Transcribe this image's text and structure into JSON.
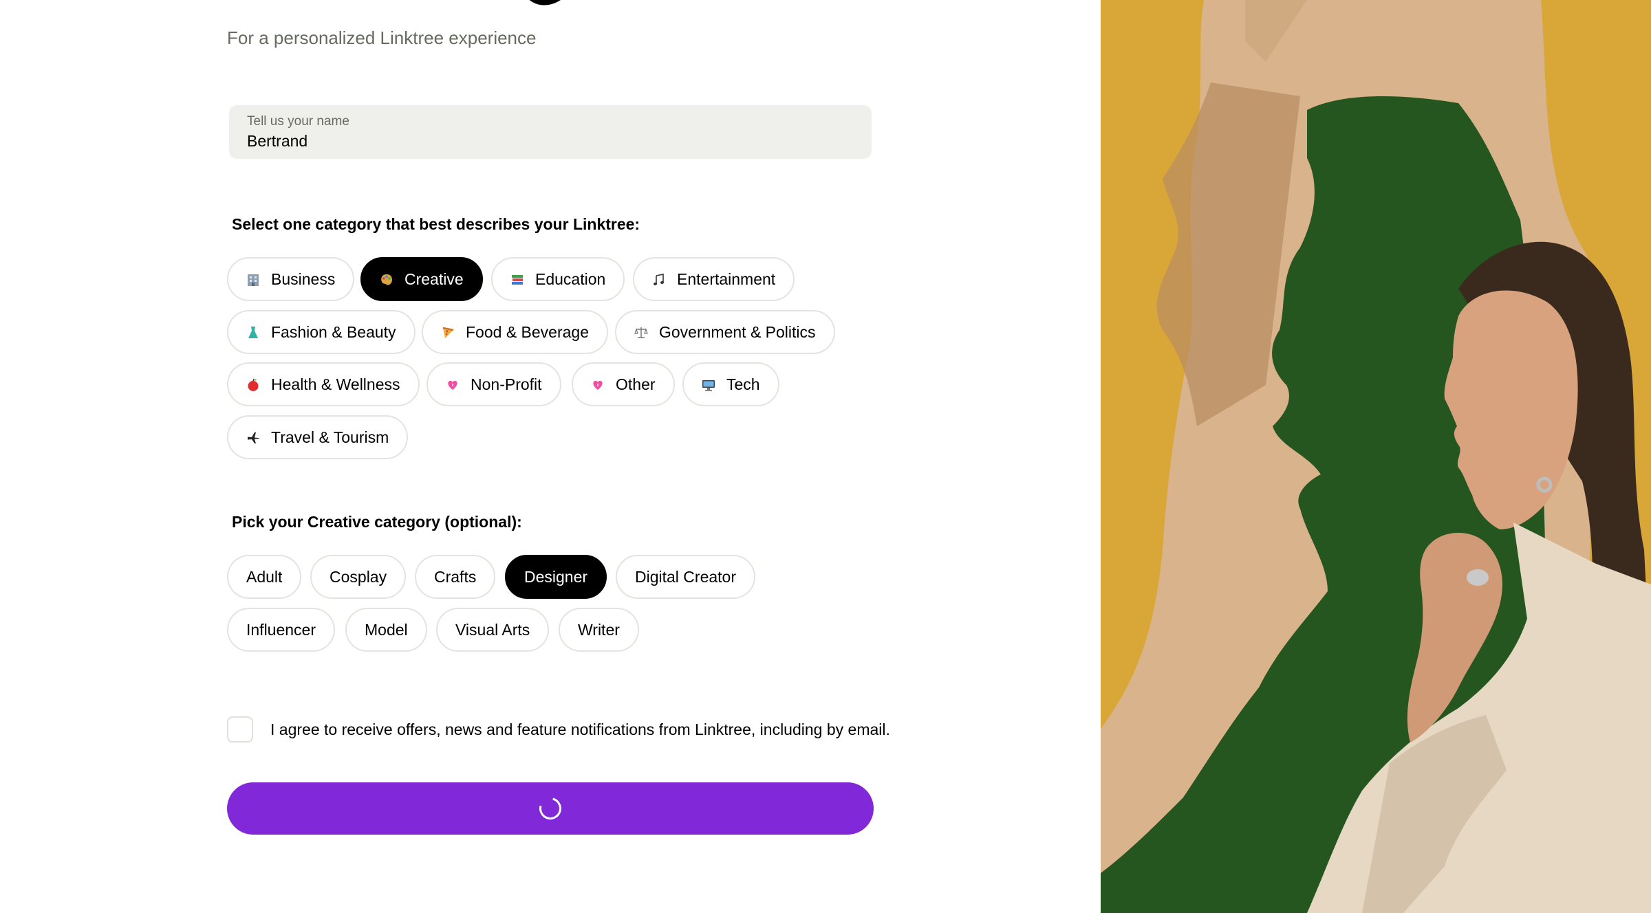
{
  "header": {
    "subtitle": "For a personalized Linktree experience"
  },
  "name_field": {
    "label": "Tell us your name",
    "value": "Bertrand"
  },
  "category_section": {
    "label": "Select one category that best describes your Linktree:",
    "selected": "Creative",
    "options": [
      {
        "label": "Business",
        "icon": "office-building-icon"
      },
      {
        "label": "Creative",
        "icon": "artist-palette-icon"
      },
      {
        "label": "Education",
        "icon": "books-icon"
      },
      {
        "label": "Entertainment",
        "icon": "musical-notes-icon"
      },
      {
        "label": "Fashion & Beauty",
        "icon": "dress-icon"
      },
      {
        "label": "Food & Beverage",
        "icon": "pizza-icon"
      },
      {
        "label": "Government & Politics",
        "icon": "balance-scale-icon"
      },
      {
        "label": "Health & Wellness",
        "icon": "apple-icon"
      },
      {
        "label": "Non-Profit",
        "icon": "sparkling-heart-icon"
      },
      {
        "label": "Other",
        "icon": "sparkling-heart-icon"
      },
      {
        "label": "Tech",
        "icon": "desktop-computer-icon"
      },
      {
        "label": "Travel & Tourism",
        "icon": "airplane-icon"
      }
    ]
  },
  "subcategory_section": {
    "label": "Pick your Creative category (optional):",
    "selected": "Designer",
    "options": [
      "Adult",
      "Cosplay",
      "Crafts",
      "Designer",
      "Digital Creator",
      "Influencer",
      "Model",
      "Visual Arts",
      "Writer"
    ]
  },
  "consent": {
    "text": "I agree to receive offers, news and feature notifications from Linktree, including by email.",
    "checked": false
  },
  "submit": {
    "state": "loading"
  },
  "colors": {
    "accent_purple": "#8129d9",
    "selected_chip": "#000000",
    "field_background": "#efefec",
    "hero_mustard": "#d9a638",
    "hero_green": "#26561f"
  }
}
